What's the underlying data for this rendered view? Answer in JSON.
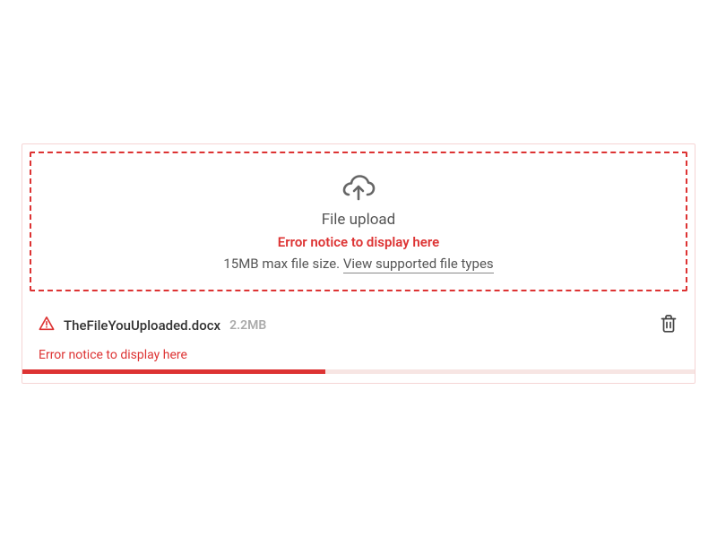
{
  "dropzone": {
    "title": "File upload",
    "error": "Error notice to display here",
    "hint_prefix": "15MB max file size. ",
    "hint_link": "View supported file types"
  },
  "file": {
    "name": "TheFileYouUploaded.docx",
    "size": "2.2MB",
    "error": "Error notice to display here",
    "progress_percent": 45
  },
  "colors": {
    "error": "#d33",
    "muted": "#555"
  }
}
